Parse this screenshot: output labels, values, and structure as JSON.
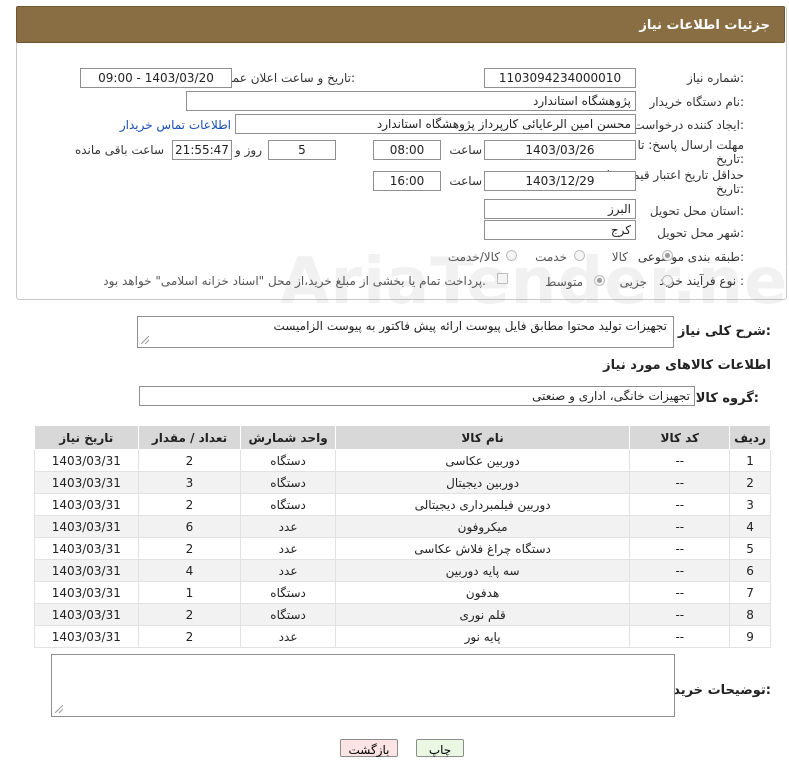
{
  "header": {
    "title": "جزئیات اطلاعات نیاز"
  },
  "form": {
    "need_number_label": "شماره نیاز:",
    "need_number": "1103094234000010",
    "announce_label": "تاریخ و ساعت اعلان عمومی:",
    "announce_value": "1403/03/20 - 09:00",
    "buyer_org_label": "نام دستگاه خریدار:",
    "buyer_org": "پژوهشگاه استاندارد",
    "creator_label": "ایجاد کننده درخواست:",
    "creator": "محسن امین الرعایائی کارپرداز پژوهشگاه استاندارد",
    "contact_link": "اطلاعات تماس خریدار",
    "reply_deadline_label_1": "مهلت ارسال پاسخ: تا",
    "reply_deadline_label_2": "تاریخ:",
    "reply_date": "1403/03/26",
    "time_label": "ساعت",
    "reply_time": "08:00",
    "days_value": "5",
    "days_label": "روز و",
    "remaining_time": "21:55:47",
    "remaining_label": "ساعت باقی مانده",
    "price_validity_label_1": "حداقل تاریخ اعتبار قیمت: تا",
    "price_validity_label_2": "تاریخ:",
    "price_date": "1403/12/29",
    "price_time": "16:00",
    "province_label": "استان محل تحویل:",
    "province": "البرز",
    "city_label": "شهر محل تحویل:",
    "city": "کرج",
    "category_label": "طبقه بندی موضوعی:",
    "category_options": [
      "کالا",
      "خدمت",
      "کالا/خدمت"
    ],
    "process_label": "نوع فرآیند خرید :",
    "process_options": [
      "جزیی",
      "متوسط"
    ],
    "payment_note": "پرداخت تمام یا بخشی از مبلغ خرید،از محل \"اسناد خزانه اسلامی\" خواهد بود."
  },
  "description": {
    "label": "شرح کلی نیاز:",
    "value": "تجهیزات تولید محتوا مطابق فایل پیوست ارائه پیش فاکتور به پیوست الزامیست"
  },
  "goods": {
    "section_title": "اطلاعات کالاهای مورد نیاز",
    "group_label": "گروه کالا:",
    "group_value": "تجهیزات خانگی، اداری و صنعتی",
    "columns": [
      "ردیف",
      "کد کالا",
      "نام کالا",
      "واحد شمارش",
      "تعداد / مقدار",
      "تاریخ نیاز"
    ],
    "rows": [
      [
        "1",
        "--",
        "دوربین عکاسی",
        "دستگاه",
        "2",
        "1403/03/31"
      ],
      [
        "2",
        "--",
        "دوربین دیجیتال",
        "دستگاه",
        "3",
        "1403/03/31"
      ],
      [
        "3",
        "--",
        "دوربین فیلمبرداری دیجیتالی",
        "دستگاه",
        "2",
        "1403/03/31"
      ],
      [
        "4",
        "--",
        "میکروفون",
        "عدد",
        "6",
        "1403/03/31"
      ],
      [
        "5",
        "--",
        "دستگاه چراغ فلاش عکاسی",
        "عدد",
        "2",
        "1403/03/31"
      ],
      [
        "6",
        "--",
        "سه پایه دوربین",
        "عدد",
        "4",
        "1403/03/31"
      ],
      [
        "7",
        "--",
        "هدفون",
        "دستگاه",
        "1",
        "1403/03/31"
      ],
      [
        "8",
        "--",
        "قلم نوری",
        "دستگاه",
        "2",
        "1403/03/31"
      ],
      [
        "9",
        "--",
        "پایه نور",
        "عدد",
        "2",
        "1403/03/31"
      ]
    ]
  },
  "buyer_notes": {
    "label": "توضیحات خریدار:",
    "value": ""
  },
  "buttons": {
    "print": "چاپ",
    "back": "بازگشت"
  },
  "colors": {
    "header_bg": "#8a6e43",
    "link": "#1a4fb5",
    "print_bg": "#e9f7e3",
    "back_bg": "#fde4e4"
  }
}
